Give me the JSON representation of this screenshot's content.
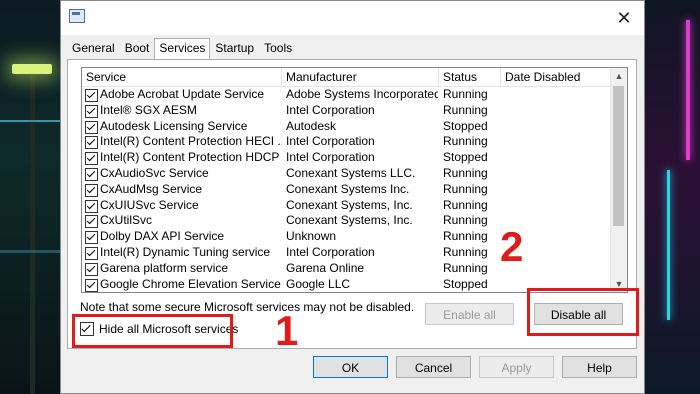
{
  "tabs": [
    {
      "label": "General",
      "active": false
    },
    {
      "label": "Boot",
      "active": false
    },
    {
      "label": "Services",
      "active": true
    },
    {
      "label": "Startup",
      "active": false
    },
    {
      "label": "Tools",
      "active": false
    }
  ],
  "columns": {
    "service": "Service",
    "manufacturer": "Manufacturer",
    "status": "Status",
    "date_disabled": "Date Disabled"
  },
  "services": [
    {
      "name": "Adobe Acrobat Update Service",
      "manufacturer": "Adobe Systems Incorporated",
      "status": "Running",
      "checked": true
    },
    {
      "name": "Intel® SGX AESM",
      "manufacturer": "Intel Corporation",
      "status": "Running",
      "checked": true
    },
    {
      "name": "Autodesk Licensing Service",
      "manufacturer": "Autodesk",
      "status": "Stopped",
      "checked": true
    },
    {
      "name": "Intel(R) Content Protection HECI ...",
      "manufacturer": "Intel Corporation",
      "status": "Running",
      "checked": true
    },
    {
      "name": "Intel(R) Content Protection HDCP ...",
      "manufacturer": "Intel Corporation",
      "status": "Stopped",
      "checked": true
    },
    {
      "name": "CxAudioSvc Service",
      "manufacturer": "Conexant Systems LLC.",
      "status": "Running",
      "checked": true
    },
    {
      "name": "CxAudMsg Service",
      "manufacturer": "Conexant Systems Inc.",
      "status": "Running",
      "checked": true
    },
    {
      "name": "CxUIUSvc Service",
      "manufacturer": "Conexant Systems, Inc.",
      "status": "Running",
      "checked": true
    },
    {
      "name": "CxUtilSvc",
      "manufacturer": "Conexant Systems, Inc.",
      "status": "Running",
      "checked": true
    },
    {
      "name": "Dolby DAX API Service",
      "manufacturer": "Unknown",
      "status": "Running",
      "checked": true
    },
    {
      "name": "Intel(R) Dynamic Tuning service",
      "manufacturer": "Intel Corporation",
      "status": "Running",
      "checked": true
    },
    {
      "name": "Garena platform service",
      "manufacturer": "Garena Online",
      "status": "Running",
      "checked": true
    },
    {
      "name": "Google Chrome Elevation Service ...",
      "manufacturer": "Google LLC",
      "status": "Stopped",
      "checked": true
    }
  ],
  "note": "Note that some secure Microsoft services may not be disabled.",
  "buttons": {
    "enable_all": "Enable all",
    "disable_all": "Disable all",
    "ok": "OK",
    "cancel": "Cancel",
    "apply": "Apply",
    "help": "Help"
  },
  "hide_ms": {
    "label": "Hide all Microsoft services",
    "checked": true
  },
  "callouts": {
    "one": "1",
    "two": "2",
    "color": "#e01b1b"
  }
}
